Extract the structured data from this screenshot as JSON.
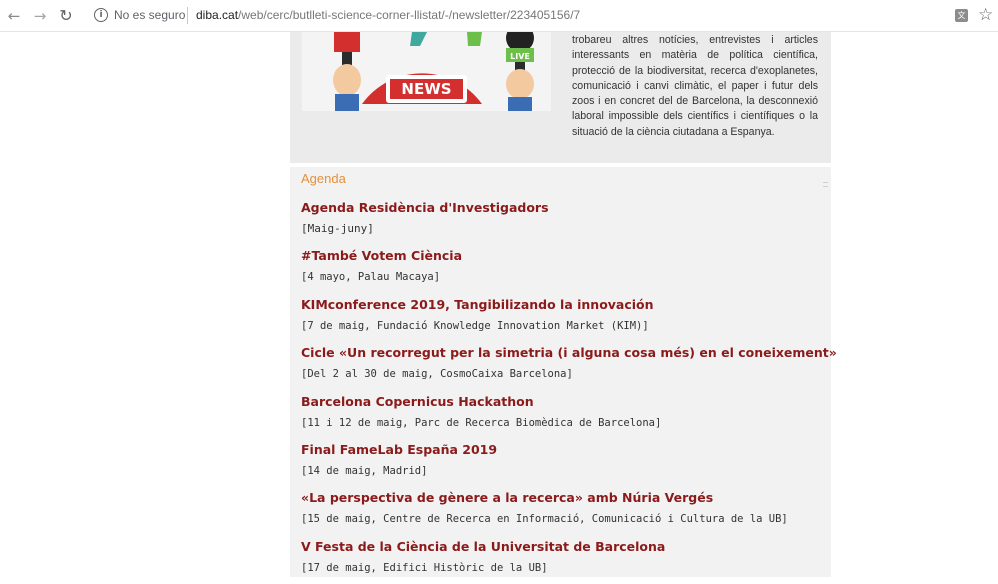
{
  "browser": {
    "security_label": "No es seguro",
    "url_host": "diba.cat",
    "url_path": "/web/cerc/butlleti-science-corner-llistat/-/newsletter/223405156/7",
    "icons": [
      "back-arrow-icon",
      "forward-arrow-icon",
      "reload-icon",
      "info-icon",
      "translate-icon",
      "star-icon"
    ]
  },
  "intro": {
    "image_label": "NEWS",
    "mic_label": "LIVE",
    "text": "trobareu altres notícies, entrevistes i articles interessants en matèria de política científica, protecció de la biodiversitat, recerca d'exoplanetes, comunicació i canvi climàtic, el paper i futur dels zoos i en concret del de Barcelona, la desconnexió laboral impossible dels científics i científiques o la situació de la ciència ciutadana a Espanya."
  },
  "agenda": {
    "title": "Agenda",
    "events": [
      {
        "title": "Agenda Residència d'Investigadors",
        "date": "[Maig-juny]"
      },
      {
        "title": "#També Votem Ciència",
        "date": "[4 mayo, Palau Macaya]"
      },
      {
        "title": "KIMconference 2019, Tangibilizando la innovación",
        "date": "[7 de maig, Fundació Knowledge Innovation Market (KIM)]"
      },
      {
        "title": "Cicle «Un recorregut per la simetria (i alguna cosa més) en el coneixement»",
        "date": "[Del 2 al 30 de maig, CosmoCaixa  Barcelona]"
      },
      {
        "title": "Barcelona Copernicus Hackathon",
        "date": "[11 i 12 de maig, Parc de Recerca Biomèdica de Barcelona]"
      },
      {
        "title": "Final FameLab España 2019",
        "date": "[14 de maig, Madrid]"
      },
      {
        "title": "«La perspectiva de gènere a la recerca» amb Núria Vergés",
        "date": "[15 de maig, Centre de Recerca en Informació, Comunicació i Cultura de la UB]"
      },
      {
        "title": "V Festa de la Ciència de la Universitat de Barcelona",
        "date": "[17 de maig, Edifici Històric de la UB]"
      }
    ]
  },
  "colors": {
    "event_title": "#8b1a1a",
    "agenda_heading": "#e69138",
    "panel_bg": "#f2f2f2"
  }
}
